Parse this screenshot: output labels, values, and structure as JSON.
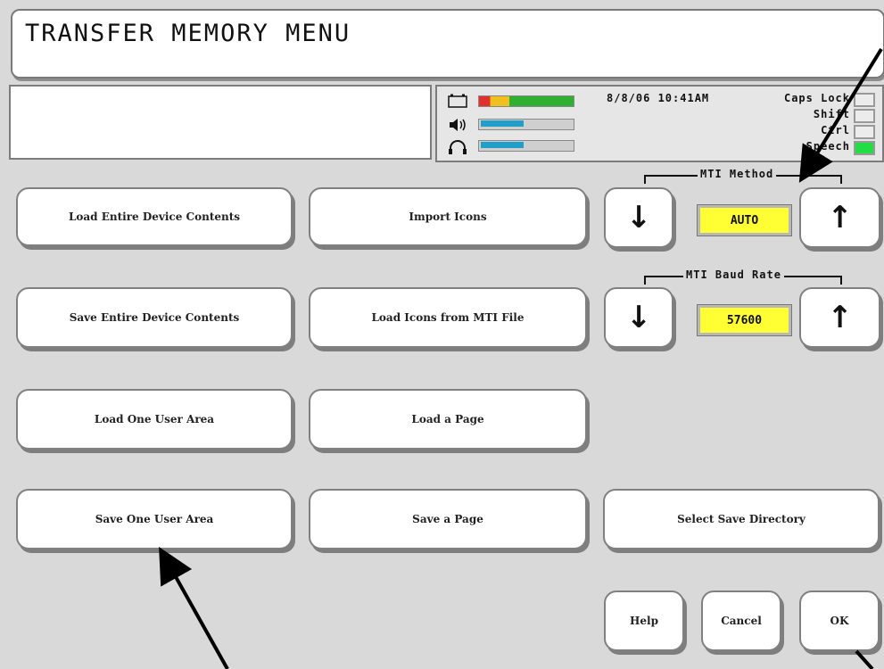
{
  "title": "TRANSFER MEMORY MENU",
  "status": {
    "datetime": "8/8/06 10:41AM",
    "indicators": [
      {
        "label": "Caps Lock",
        "on": false
      },
      {
        "label": "Shift",
        "on": false
      },
      {
        "label": "Ctrl",
        "on": false
      },
      {
        "label": "Speech",
        "on": true
      }
    ],
    "icons": [
      "battery-icon",
      "speaker-icon",
      "headphones-icon"
    ],
    "meters": [
      {
        "name": "battery-meter",
        "level": 1.0
      },
      {
        "name": "speaker-volume-meter",
        "level": 0.5
      },
      {
        "name": "headphone-volume-meter",
        "level": 0.5
      }
    ],
    "colors": {
      "speech_on": "#22dd44",
      "field_bg": "#ffff33",
      "meter_level": "#20a0c8"
    }
  },
  "buttons": {
    "load_entire": "Load Entire Device Contents",
    "import_icons": "Import Icons",
    "save_entire": "Save Entire Device Contents",
    "load_icons_mti": "Load Icons from MTI File",
    "load_one_user": "Load One User Area",
    "load_page": "Load a Page",
    "save_one_user": "Save One User Area",
    "save_page": "Save a Page",
    "select_save_dir": "Select Save Directory",
    "help": "Help",
    "cancel": "Cancel",
    "ok": "OK"
  },
  "mti_method": {
    "label": "MTI Method",
    "value": "AUTO",
    "down": "↓",
    "up": "↑"
  },
  "mti_baud": {
    "label": "MTI Baud Rate",
    "value": "57600",
    "down": "↓",
    "up": "↑"
  }
}
